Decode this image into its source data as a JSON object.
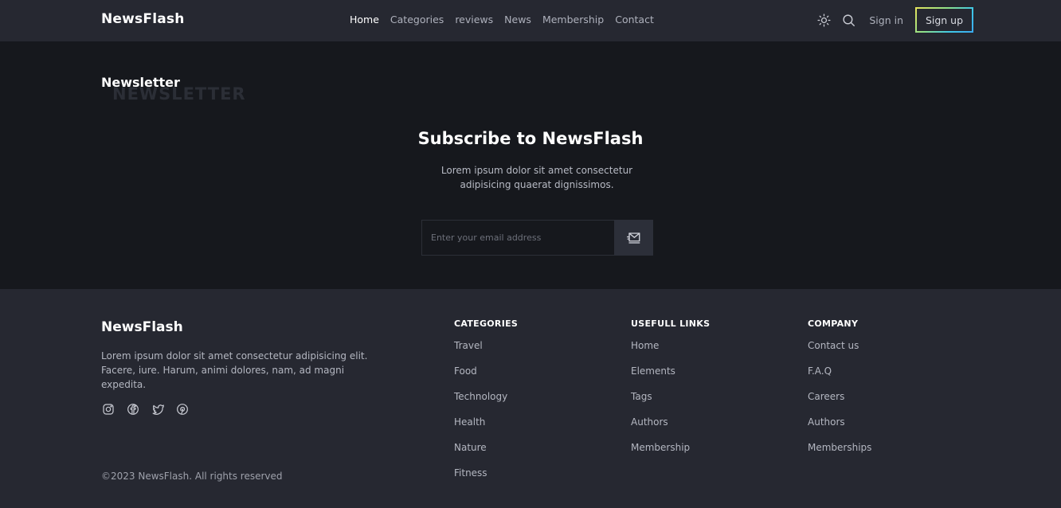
{
  "header": {
    "logo": "NewsFlash",
    "nav": [
      {
        "label": "Home",
        "active": true
      },
      {
        "label": "Categories",
        "active": false
      },
      {
        "label": "reviews",
        "active": false
      },
      {
        "label": "News",
        "active": false
      },
      {
        "label": "Membership",
        "active": false
      },
      {
        "label": "Contact",
        "active": false
      }
    ],
    "icons": [
      "sun-icon",
      "search-icon"
    ],
    "signin": "Sign in",
    "signup": "Sign up"
  },
  "newsletter": {
    "section_title": "Newsletter",
    "ghost_title": "NEWSLETTER",
    "heading": "Subscribe to NewsFlash",
    "description": "Lorem ipsum dolor sit amet consectetur adipisicing quaerat dignissimos.",
    "email_placeholder": "Enter your email address",
    "submit_icon": "mail-send-icon"
  },
  "footer": {
    "logo": "NewsFlash",
    "description": "Lorem ipsum dolor sit amet consectetur adipisicing elit. Facere, iure. Harum, animi dolores, nam, ad magni expedita.",
    "socials": [
      "instagram-icon",
      "facebook-icon",
      "twitter-icon",
      "pinterest-icon"
    ],
    "copyright": "©2023 NewsFlash. All rights reserved",
    "columns": [
      {
        "title": "CATEGORIES",
        "links": [
          "Travel",
          "Food",
          "Technology",
          "Health",
          "Nature",
          "Fitness"
        ]
      },
      {
        "title": "USEFULL LINKS",
        "links": [
          "Home",
          "Elements",
          "Tags",
          "Authors",
          "Membership"
        ]
      },
      {
        "title": "COMPANY",
        "links": [
          "Contact us",
          "F.A.Q",
          "Careers",
          "Authors",
          "Memberships"
        ]
      }
    ]
  },
  "colors": {
    "header_bg": "#262831",
    "section_bg": "#16181d",
    "footer_bg": "#262831",
    "text_primary": "#ffffff",
    "text_muted": "#b4b7c1"
  }
}
